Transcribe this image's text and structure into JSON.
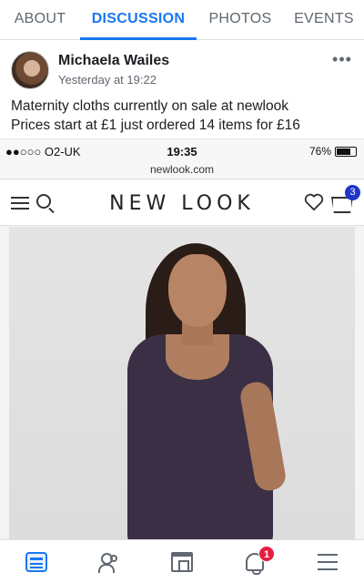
{
  "tabs": [
    {
      "label": "ABOUT"
    },
    {
      "label": "DISCUSSION"
    },
    {
      "label": "PHOTOS"
    },
    {
      "label": "EVENTS"
    }
  ],
  "post": {
    "author": "Michaela Wailes",
    "time": "Yesterday at 19:22",
    "more": "•••",
    "text_line1": "Maternity cloths currently on sale at newlook",
    "text_line2": "Prices start at £1 just ordered 14 items for £16"
  },
  "embedded": {
    "carrier": "●●○○○ O2-UK",
    "clock": "19:35",
    "battery_text": "76%",
    "battery_level": 0.76,
    "url": "newlook.com",
    "logo": "NEW LOOK",
    "bag_count": "3"
  },
  "bottom_nav": {
    "notification_count": "1",
    "active_color": "#1877f2",
    "badge_color": "#e41e3f"
  }
}
